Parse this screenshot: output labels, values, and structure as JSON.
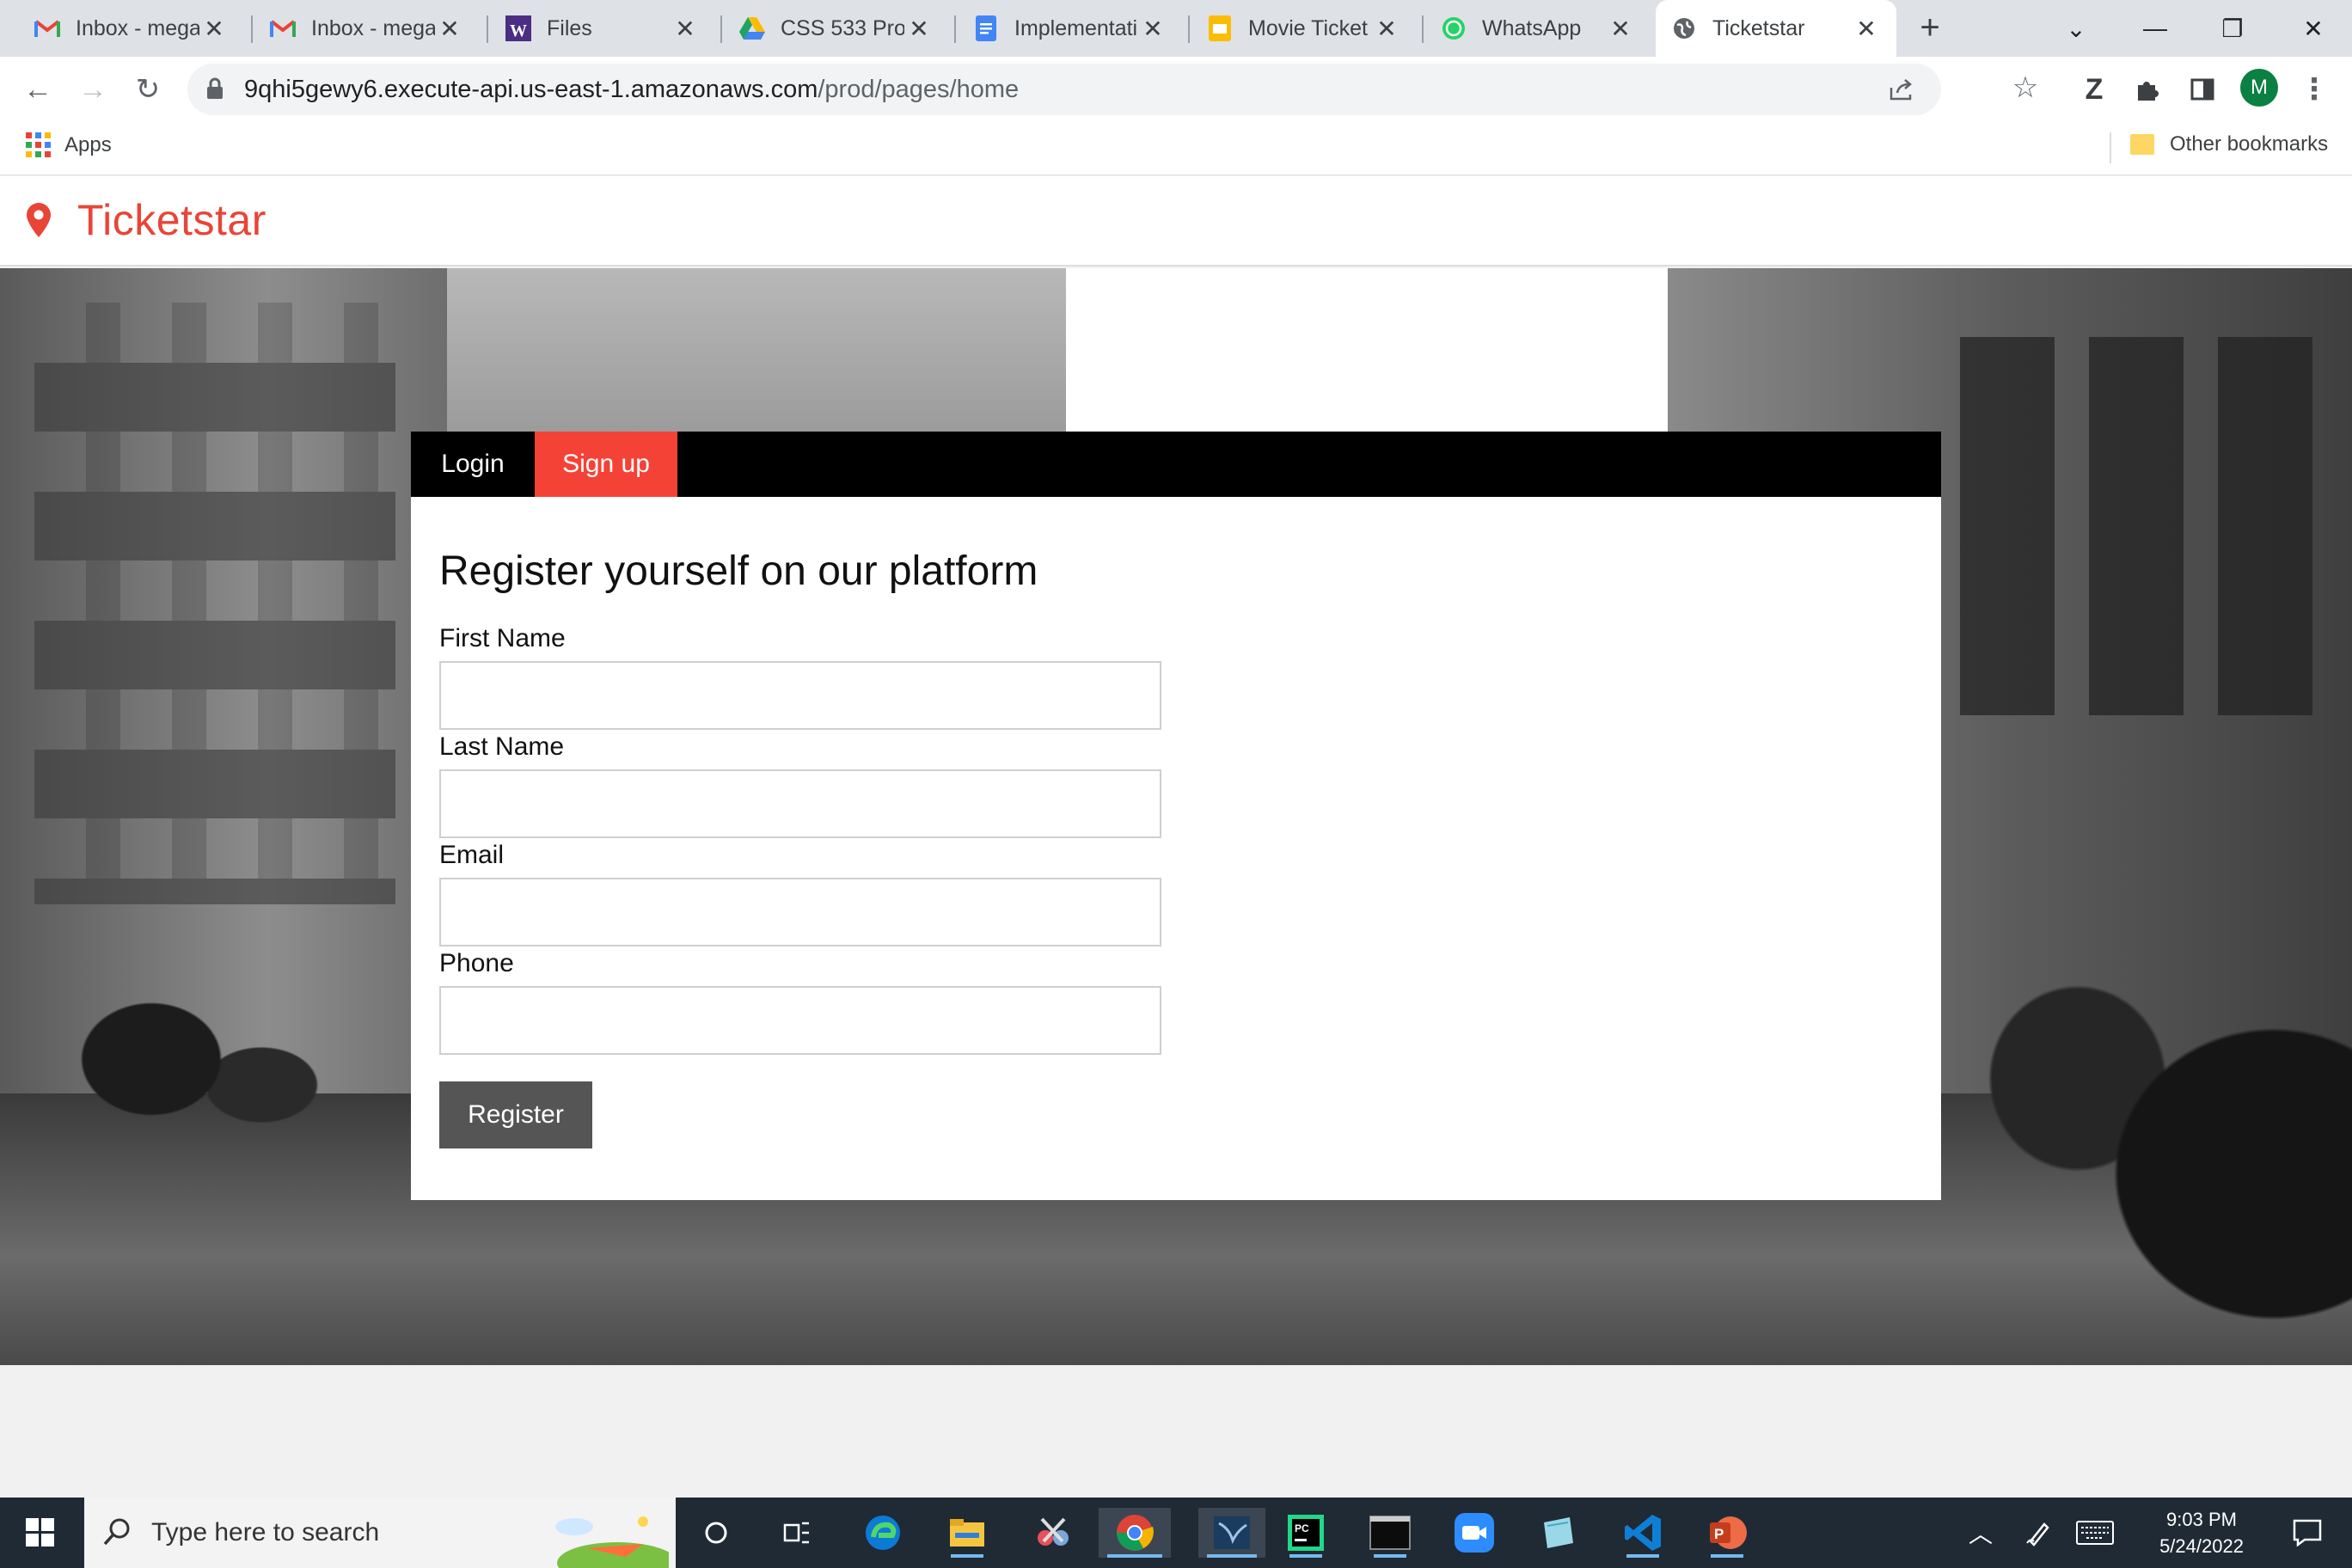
{
  "browser": {
    "tabs": [
      {
        "title": "Inbox - mega",
        "icon": "gmail-icon"
      },
      {
        "title": "Inbox - mega",
        "icon": "gmail-icon"
      },
      {
        "title": "Files",
        "icon": "w-canvas-icon"
      },
      {
        "title": "CSS 533 Prog",
        "icon": "google-drive-icon"
      },
      {
        "title": "Implementati",
        "icon": "google-docs-icon"
      },
      {
        "title": "Movie Ticket",
        "icon": "google-slides-icon"
      },
      {
        "title": "WhatsApp",
        "icon": "whatsapp-icon"
      },
      {
        "title": "Ticketstar",
        "icon": "globe-icon"
      }
    ],
    "url_host": "9qhi5gewy6.execute-api.us-east-1.amazonaws.com",
    "url_path": "/prod/pages/home",
    "profile_initial": "M",
    "bookmarks": {
      "apps_label": "Apps",
      "other_label": "Other bookmarks"
    }
  },
  "site": {
    "brand": "Ticketstar",
    "brand_color": "#e84537"
  },
  "form": {
    "tabs": {
      "login": "Login",
      "signup": "Sign up"
    },
    "title": "Register yourself on our platform",
    "fields": [
      {
        "label": "First Name",
        "value": ""
      },
      {
        "label": "Last Name",
        "value": ""
      },
      {
        "label": "Email",
        "value": ""
      },
      {
        "label": "Phone",
        "value": ""
      }
    ],
    "submit_label": "Register",
    "accent_color": "#f44336"
  },
  "taskbar": {
    "search_placeholder": "Type here to search",
    "time": "9:03 PM",
    "date": "5/24/2022"
  }
}
